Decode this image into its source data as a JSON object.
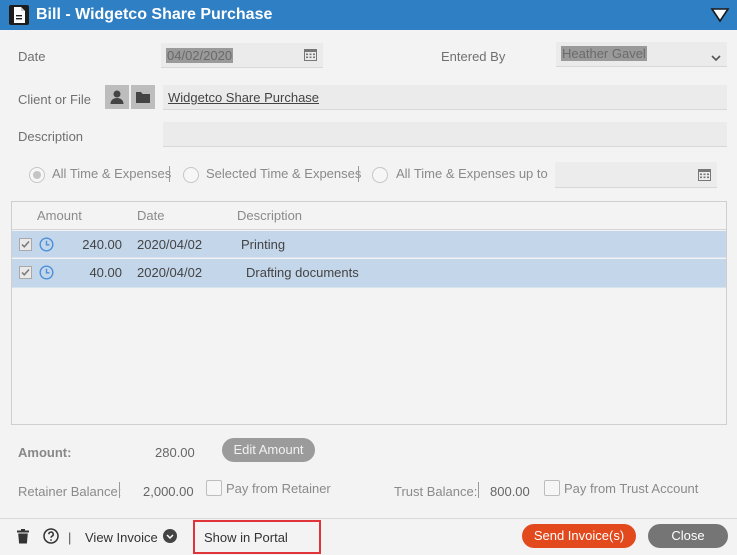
{
  "window": {
    "title": "Bill - Widgetco Share Purchase",
    "icons": {
      "document": "document-icon",
      "collapse": "triangle-down-icon"
    }
  },
  "form": {
    "date_label": "Date",
    "date_value": "04/02/2020",
    "entered_by_label": "Entered By",
    "entered_by_value": "Heather Gavel",
    "client_label": "Client or File",
    "client_value": "Widgetco Share Purchase",
    "description_label": "Description",
    "description_value": ""
  },
  "filters": {
    "options": [
      {
        "label": "All Time & Expenses",
        "selected": true
      },
      {
        "label": "Selected Time & Expenses",
        "selected": false
      },
      {
        "label": "All Time & Expenses up to",
        "selected": false
      }
    ],
    "up_to_value": ""
  },
  "table": {
    "columns": [
      "Amount",
      "Date",
      "Description"
    ],
    "rows": [
      {
        "amount": "240.00",
        "date": "2020/04/02",
        "description": "Printing",
        "checked": true
      },
      {
        "amount": "40.00",
        "date": "2020/04/02",
        "description": "Drafting documents",
        "checked": true
      }
    ]
  },
  "totals": {
    "amount_label": "Amount:",
    "amount_value": "280.00",
    "edit_amount_label": "Edit Amount",
    "retainer_label": "Retainer Balance:",
    "retainer_value": "2,000.00",
    "pay_retainer_label": "Pay from Retainer",
    "trust_label": "Trust Balance:",
    "trust_value": "800.00",
    "pay_trust_label": "Pay from Trust Account"
  },
  "footer": {
    "view_invoice_label": "View Invoice",
    "separator": "|",
    "show_portal_label": "Show in Portal",
    "send_label": "Send Invoice(s)",
    "close_label": "Close"
  },
  "colors": {
    "titlebar": "#2f7fc4",
    "row_selected": "#c4d6ea",
    "send_button": "#e24a1d",
    "close_button": "#757575",
    "highlight_border": "#e0343a"
  }
}
